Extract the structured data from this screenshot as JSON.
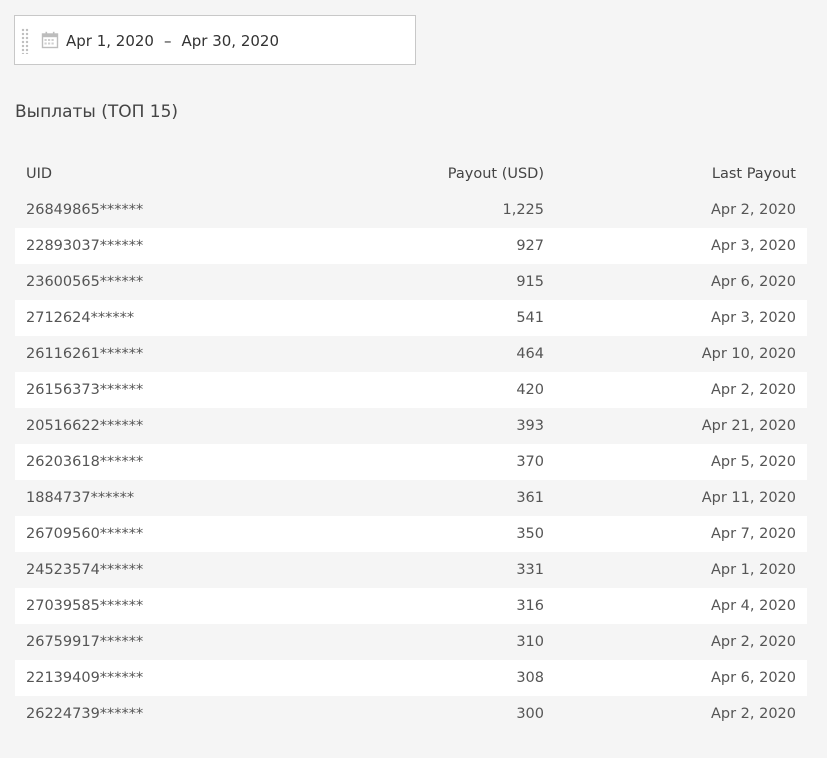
{
  "date_range": {
    "start": "Apr 1, 2020",
    "separator": "–",
    "end": "Apr 30, 2020"
  },
  "section_title": "Выплаты (ТОП 15)",
  "table": {
    "headers": {
      "uid": "UID",
      "payout": "Payout (USD)",
      "last_payout": "Last Payout"
    },
    "rows": [
      {
        "uid": "26849865******",
        "payout": "1,225",
        "last_payout": "Apr 2, 2020"
      },
      {
        "uid": "22893037******",
        "payout": "927",
        "last_payout": "Apr 3, 2020"
      },
      {
        "uid": "23600565******",
        "payout": "915",
        "last_payout": "Apr 6, 2020"
      },
      {
        "uid": "2712624******",
        "payout": "541",
        "last_payout": "Apr 3, 2020"
      },
      {
        "uid": "26116261******",
        "payout": "464",
        "last_payout": "Apr 10, 2020"
      },
      {
        "uid": "26156373******",
        "payout": "420",
        "last_payout": "Apr 2, 2020"
      },
      {
        "uid": "20516622******",
        "payout": "393",
        "last_payout": "Apr 21, 2020"
      },
      {
        "uid": "26203618******",
        "payout": "370",
        "last_payout": "Apr 5, 2020"
      },
      {
        "uid": "1884737******",
        "payout": "361",
        "last_payout": "Apr 11, 2020"
      },
      {
        "uid": "26709560******",
        "payout": "350",
        "last_payout": "Apr 7, 2020"
      },
      {
        "uid": "24523574******",
        "payout": "331",
        "last_payout": "Apr 1, 2020"
      },
      {
        "uid": "27039585******",
        "payout": "316",
        "last_payout": "Apr 4, 2020"
      },
      {
        "uid": "26759917******",
        "payout": "310",
        "last_payout": "Apr 2, 2020"
      },
      {
        "uid": "22139409******",
        "payout": "308",
        "last_payout": "Apr 6, 2020"
      },
      {
        "uid": "26224739******",
        "payout": "300",
        "last_payout": "Apr 2, 2020"
      }
    ]
  },
  "icons": {
    "calendar": "calendar-icon",
    "drag_handle": "drag-handle-icon"
  },
  "colors": {
    "page_background": "#f5f5f5",
    "row_white": "#ffffff",
    "text": "#444444",
    "border": "#c8c8c8"
  }
}
